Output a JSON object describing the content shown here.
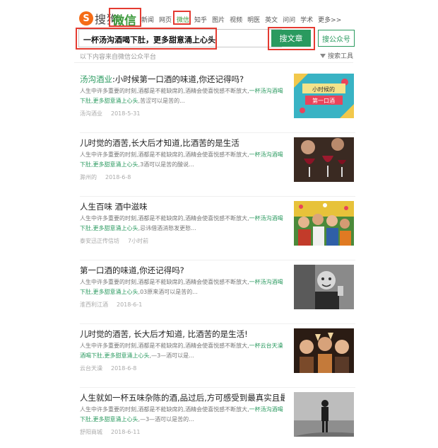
{
  "header": {
    "logo_mark": "S",
    "logo_text": "搜狗",
    "product": "微信",
    "nav": [
      "新闻",
      "网页",
      "微信",
      "知乎",
      "图片",
      "视频",
      "明医",
      "英文",
      "问问",
      "学术",
      "更多>>"
    ],
    "active_nav": "微信"
  },
  "search": {
    "query": "一杯汤沟酒喝下肚，更多甜意涌上心头",
    "article_button": "搜文章",
    "account_button": "搜公众号",
    "hint": "以下内容来自微信公众平台",
    "tools": "搜索工具"
  },
  "colors": {
    "accent": "#2a9a5f",
    "annotation": "#e43b31",
    "logo": "#f56c16"
  },
  "results": [
    {
      "title_hl": "汤沟酒业",
      "title": ":小时候第一口酒的味道,你还记得吗?",
      "abstract": "人生中许多重要的时刻,酒都是不能缺席的,酒精会使喜悦感不断放大,",
      "abstract_hl": "一杯汤沟酒喝下肚,更多甜意涌上心头",
      "abstract_tail": ",苦涩可以是苦的...",
      "source": "汤沟酒业",
      "date": "2018-5-31",
      "thumb_text": "小时候的 第一口酒",
      "thumb_icon": "poster-icon"
    },
    {
      "title_hl": "",
      "title": "儿时觉的酒苦,长大后才知道,比酒苦的是生活",
      "abstract": "人生中许多重要的时刻,酒都是不能缺席的,酒精会使喜悦感不断放大,",
      "abstract_hl": "一杯汤沟酒喝下肚,更多甜意涌上心头",
      "abstract_tail": ",3酒可以是苦的酸说...",
      "source": "滁州的",
      "date": "2018-6-8",
      "thumb_text": "",
      "thumb_icon": "wine-glasses-icon"
    },
    {
      "title_hl": "",
      "title": "人生百味 酒中滋味",
      "abstract": "人生中许多重要的时刻,酒都是不能缺席的,酒精会使喜悦感不断放大,",
      "abstract_hl": "一杯汤沟酒喝下肚,更多甜意涌上心头",
      "abstract_tail": ",忌讳借酒消愁发更愁...",
      "source": "泰安迅正传信坊",
      "date": "7小时前",
      "thumb_text": "",
      "thumb_icon": "party-icon"
    },
    {
      "title_hl": "",
      "title": "第一口酒的味道,你还记得吗?",
      "abstract": "人生中许多重要的时刻,酒都是不能缺席的,酒精会使喜悦感不断放大,",
      "abstract_hl": "一杯汤沟酒喝下肚,更多甜意涌上心头",
      "abstract_tail": ",03原来酒可以是苦的...",
      "source": "淮西利江酒",
      "date": "2018-6-1",
      "thumb_text": "",
      "thumb_icon": "child-photo-icon"
    },
    {
      "title_hl": "",
      "title": "儿时觉的酒苦, 长大后才知道, 比酒苦的是生活!",
      "abstract": "人生中许多重要的时刻,酒都是不能缺席的,酒精会使喜悦感不断放大,",
      "abstract_hl": "一杯云台天澡酒喝下肚,更多甜意涌上心头",
      "abstract_tail": ",—3—酒可以是...",
      "source": "云台天澡",
      "date": "2018-6-8",
      "thumb_text": "",
      "thumb_icon": "toast-icon"
    },
    {
      "title_hl": "",
      "title": "人生就如一杯五味杂陈的酒,品过后,方可感受到最真实且最...",
      "abstract": "人生中许多重要的时刻,酒都是不能缺席的,酒精会使喜悦感不断放大,",
      "abstract_hl": "一杯汤沟酒喝下肚,更多甜意涌上心头",
      "abstract_tail": ",—3—酒可以是苦的...",
      "source": "舒阳商城",
      "date": "2018-6-11",
      "thumb_text": "",
      "thumb_icon": "silhouette-icon"
    }
  ]
}
